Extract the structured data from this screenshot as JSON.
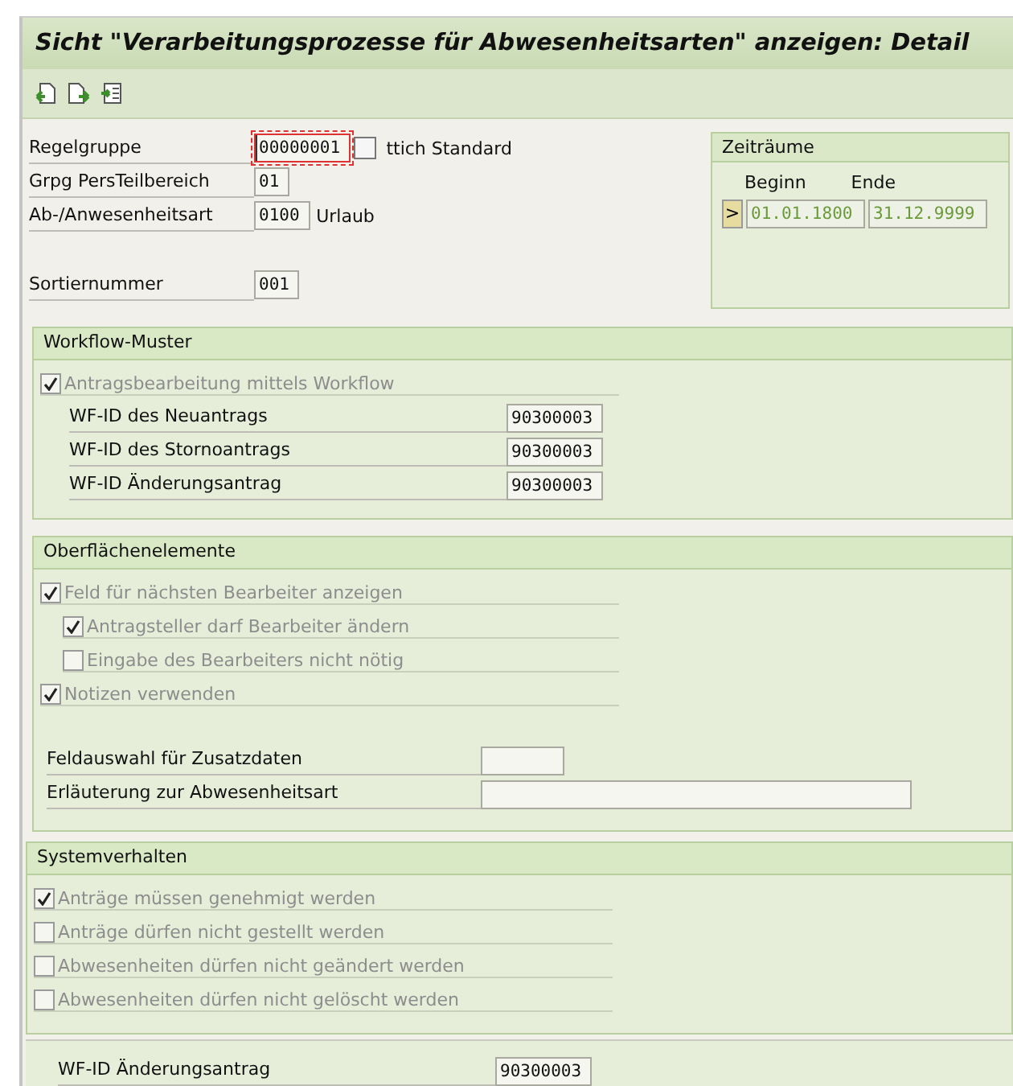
{
  "window": {
    "title": "Sicht \"Verarbeitungsprozesse für Abwesenheitsarten\" anzeigen: Detail"
  },
  "toolbar": [
    {
      "kind": "prev"
    },
    {
      "kind": "next"
    },
    {
      "kind": "select"
    }
  ],
  "header_fields": [
    {
      "label": "Regelgruppe",
      "value": "00000001",
      "focused": true,
      "help": true,
      "text": "ttich Standard"
    },
    {
      "label": "Grpg PersTeilbereich",
      "value": "01",
      "focused": false,
      "help": false
    },
    {
      "label": "Ab-/Anwesenheitsart",
      "value": "0100",
      "focused": false,
      "help": false,
      "text": "Urlaub"
    },
    {
      "label": "Sortiernummer",
      "value": "001",
      "focused": false,
      "help": false
    }
  ],
  "periods": {
    "title": "Zeiträume",
    "columns": [
      "Beginn",
      "Ende"
    ],
    "button": ">",
    "begin": "01.01.1800",
    "end": "31.12.9999"
  },
  "sections": [
    {
      "title": "Workflow-Muster",
      "items": [
        {
          "kind": "checkbox",
          "label": "Antragsbearbeitung mittels Workflow",
          "checked": true,
          "children": [
            {
              "kind": "field",
              "label": "WF-ID des Neuantrags",
              "value": "90300003"
            },
            {
              "kind": "field",
              "label": "WF-ID des Stornoantrags",
              "value": "90300003"
            },
            {
              "kind": "field",
              "label": "WF-ID Änderungsantrag",
              "value": "90300003"
            }
          ]
        }
      ]
    },
    {
      "title": "Oberflächenelemente",
      "items": [
        {
          "kind": "checkbox",
          "label": "Feld für nächsten Bearbeiter anzeigen",
          "checked": true,
          "children": [
            {
              "kind": "checkbox",
              "label": "Antragsteller darf Bearbeiter ändern",
              "checked": true
            },
            {
              "kind": "checkbox",
              "label": "Eingabe des Bearbeiters nicht nötig",
              "checked": false
            }
          ]
        },
        {
          "kind": "checkbox",
          "label": "Notizen verwenden",
          "checked": true
        },
        {
          "kind": "spacer"
        },
        {
          "kind": "field",
          "label": "Feldauswahl für Zusatzdaten"
        },
        {
          "kind": "field",
          "label": "Erläuterung zur Abwesenheitsart"
        }
      ]
    },
    {
      "title": "Systemverhalten",
      "items": [
        {
          "kind": "checkbox",
          "label": "Anträge müssen genehmigt werden",
          "checked": true
        },
        {
          "kind": "checkbox",
          "label": "Anträge dürfen nicht gestellt werden",
          "checked": false
        },
        {
          "kind": "checkbox",
          "label": "Abwesenheiten dürfen nicht geändert werden",
          "checked": false
        },
        {
          "kind": "checkbox",
          "label": "Abwesenheiten dürfen nicht gelöscht werden",
          "checked": false
        }
      ]
    }
  ],
  "footer_field": {
    "label": "WF-ID Änderungsantrag",
    "value": "90300003"
  }
}
